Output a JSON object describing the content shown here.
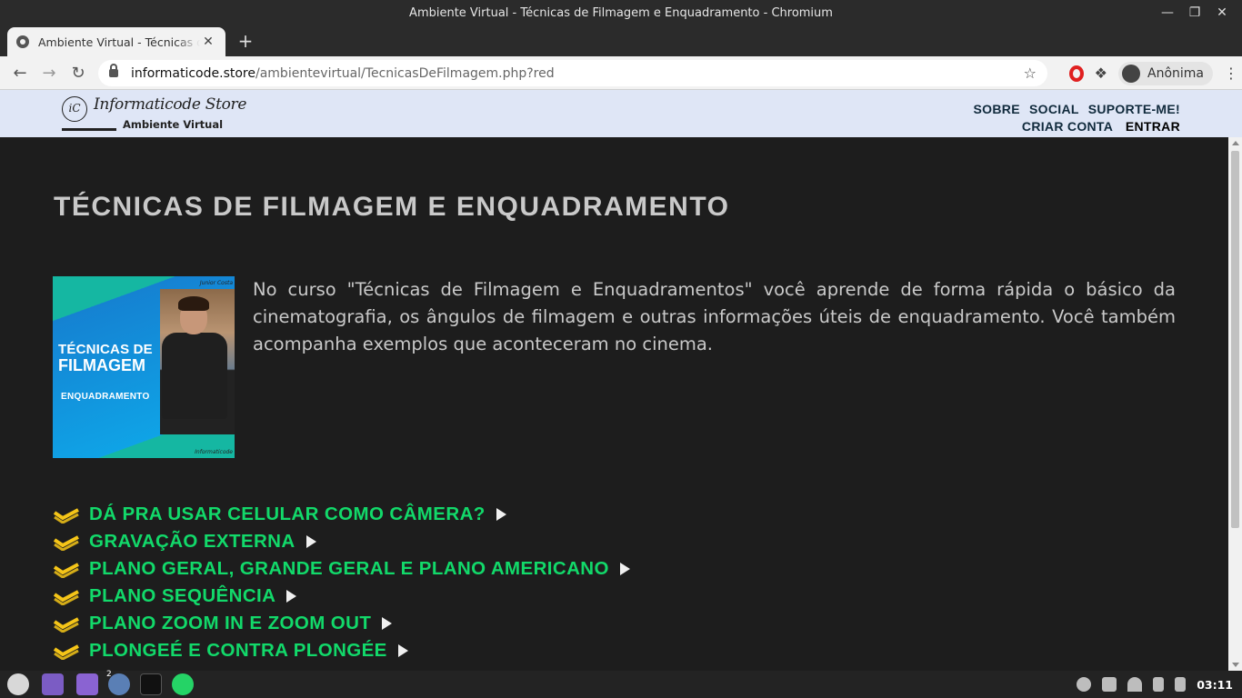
{
  "window": {
    "title": "Ambiente Virtual - Técnicas de Filmagem e Enquadramento - Chromium"
  },
  "tab": {
    "title": "Ambiente Virtual - Técnicas de Filmagem e Enquadramento",
    "new_tab": "+"
  },
  "address": {
    "host": "informaticode.store",
    "path": "/ambientevirtual/TecnicasDeFilmagem.php?red"
  },
  "profile": {
    "label": "Anônima"
  },
  "site": {
    "logo_name": "Informaticode Store",
    "logo_sub": "Ambiente Virtual",
    "nav": {
      "sobre": "SOBRE",
      "social": "SOCIAL",
      "suporte": "SUPORTE-ME!",
      "criar_conta": "CRIAR CONTA",
      "entrar": "ENTRAR"
    }
  },
  "main": {
    "title": "TÉCNICAS DE FILMAGEM E ENQUADRAMENTO",
    "cover": {
      "line1": "TÉCNICAS DE",
      "line2": "FILMAGEM",
      "line3": "ENQUADRAMENTO",
      "author": "Junior Costa",
      "brand": "Informaticode"
    },
    "description": "No curso \"Técnicas de Filmagem e Enquadramentos\" você aprende de forma rápida o básico da cinematografia, os ângulos de filmagem e outras informações úteis de enquadramento. Você também acompanha exemplos que aconteceram no cinema.",
    "lessons": [
      "DÁ PRA USAR CELULAR COMO CÂMERA?",
      "GRAVAÇÃO EXTERNA",
      "PLANO GERAL, GRANDE GERAL E PLANO AMERICANO",
      "PLANO SEQUÊNCIA",
      "PLANO ZOOM IN E ZOOM OUT",
      "PLONGEÉ E CONTRA PLONGÉE"
    ]
  },
  "colors": {
    "lesson_green": "#12d96a",
    "check_yellow": "#f5c518",
    "header_bg": "#dfe6f6",
    "page_bg": "#1d1d1d"
  },
  "taskbar": {
    "clock": "03:11",
    "browser_badge": "2"
  }
}
